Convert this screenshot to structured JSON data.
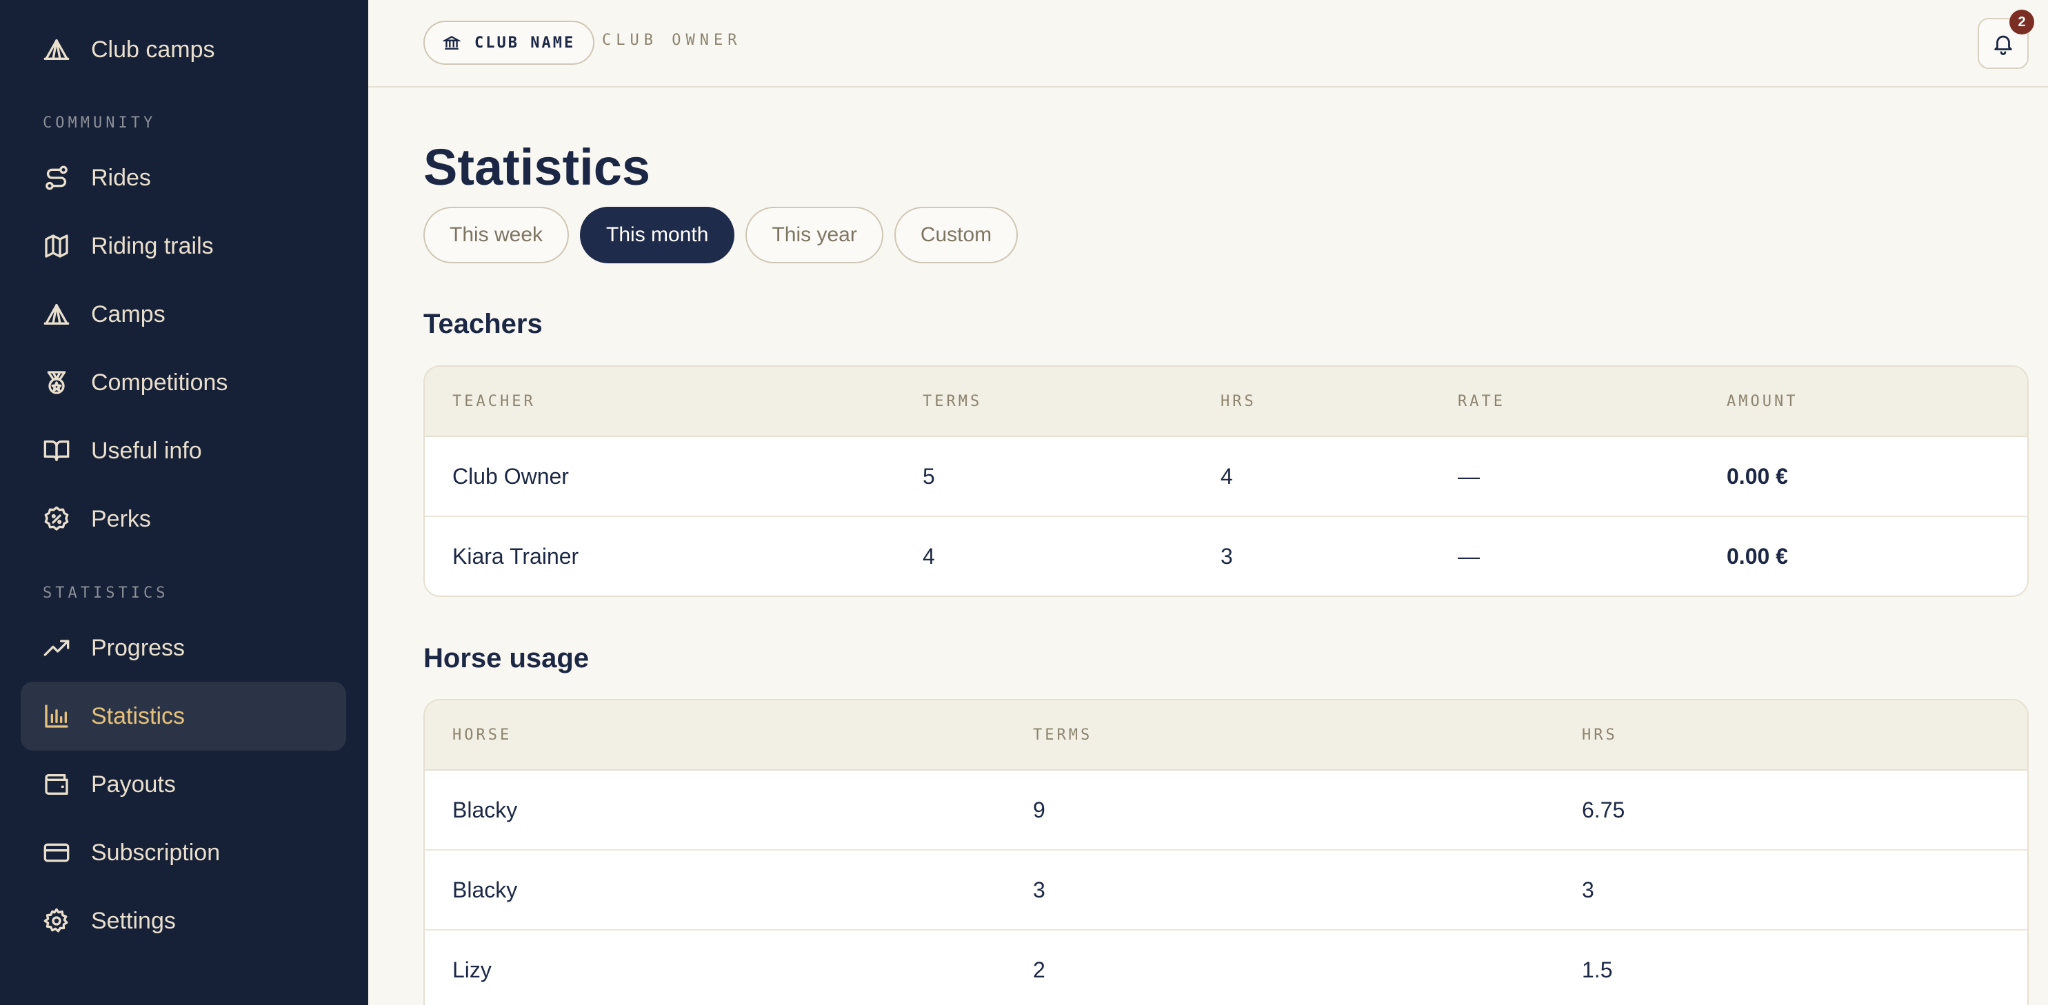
{
  "sidebar": {
    "top_item": "Club camps",
    "community_label": "COMMUNITY",
    "community_items": [
      "Rides",
      "Riding trails",
      "Camps",
      "Competitions",
      "Useful info",
      "Perks"
    ],
    "statistics_label": "STATISTICS",
    "statistics_items": [
      "Progress",
      "Statistics",
      "Payouts",
      "Subscription",
      "Settings"
    ],
    "active_item": "Statistics"
  },
  "topbar": {
    "club_name": "CLUB NAME",
    "owner_label": "CLUB OWNER",
    "notification_count": "2"
  },
  "page": {
    "title": "Statistics",
    "filters": [
      "This week",
      "This month",
      "This year",
      "Custom"
    ],
    "active_filter": "This month"
  },
  "teachers": {
    "title": "Teachers",
    "columns": [
      "TEACHER",
      "TERMS",
      "HRS",
      "RATE",
      "AMOUNT"
    ],
    "rows": [
      {
        "teacher": "Club Owner",
        "terms": "5",
        "hrs": "4",
        "rate": "—",
        "amount": "0.00 €"
      },
      {
        "teacher": "Kiara Trainer",
        "terms": "4",
        "hrs": "3",
        "rate": "—",
        "amount": "0.00 €"
      }
    ]
  },
  "horse_usage": {
    "title": "Horse usage",
    "columns": [
      "HORSE",
      "TERMS",
      "HRS"
    ],
    "rows": [
      {
        "horse": "Blacky",
        "terms": "9",
        "hrs": "6.75"
      },
      {
        "horse": "Blacky",
        "terms": "3",
        "hrs": "3"
      },
      {
        "horse": "Lizy",
        "terms": "2",
        "hrs": "1.5"
      }
    ]
  },
  "colors": {
    "sidebar_bg": "#162036",
    "accent_active": "#e5c17d",
    "primary_dark": "#1f2b4a",
    "badge": "#7b2e23",
    "page_bg": "#f9f7f1"
  }
}
